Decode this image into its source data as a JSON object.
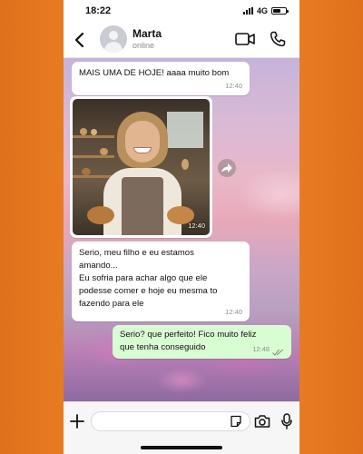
{
  "status_bar": {
    "time": "18:22",
    "network": "4G",
    "battery_level": 0.6
  },
  "contact": {
    "name": "Marta",
    "status": "online"
  },
  "icons": {
    "back": "chevron-left-icon",
    "video": "video-camera-icon",
    "call": "phone-icon",
    "forward": "forward-icon",
    "add": "plus-icon",
    "sticker": "sticker-icon",
    "camera": "camera-icon",
    "mic": "microphone-icon",
    "read_receipt": "double-check-icon"
  },
  "colors": {
    "outgoing_bubble": "#d9fdd3",
    "incoming_bubble": "#ffffff",
    "read_ticks": "#8e8e8e",
    "background_frame": "#f08a2a"
  },
  "messages": [
    {
      "direction": "incoming",
      "type": "text",
      "text": "MAIS UMA DE HOJE! aaaa muito bom",
      "time": "12:40"
    },
    {
      "direction": "incoming",
      "type": "image",
      "time": "12:40"
    },
    {
      "direction": "incoming",
      "type": "text",
      "text": "Serio, meu filho e eu estamos\namando...\nEu sofria para achar algo que ele\npodesse comer e hoje eu mesma to\nfazendo para ele",
      "time": "12:40"
    },
    {
      "direction": "outgoing",
      "type": "text",
      "text": "Serio? que perfeito! Fico muito feliz\nque tenha conseguido",
      "time": "12:48"
    }
  ],
  "composer": {
    "placeholder": "",
    "value": ""
  }
}
